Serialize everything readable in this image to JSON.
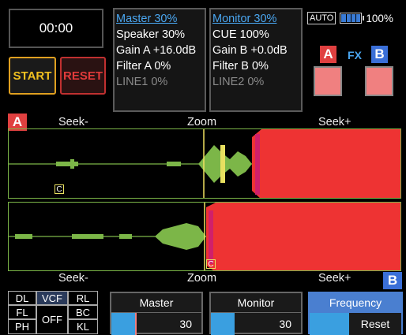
{
  "timer": "00:00",
  "buttons": {
    "start": "START",
    "reset": "RESET"
  },
  "master_panel": {
    "title": "Master 30%",
    "lines": [
      "Speaker 30%",
      "Gain A +16.0dB",
      "Filter A 0%",
      "LINE1 0%"
    ]
  },
  "monitor_panel": {
    "title": "Monitor 30%",
    "lines": [
      "CUE 100%",
      "Gain B +0.0dB",
      "Filter B 0%",
      "LINE2 0%"
    ]
  },
  "status": {
    "auto": "AUTO",
    "battery": "100%",
    "battery_level": 1.0
  },
  "fx": {
    "deck_a": "A",
    "label": "FX",
    "deck_b": "B"
  },
  "deck_a": {
    "label": "A",
    "seek_minus": "Seek-",
    "zoom": "Zoom",
    "seek_plus": "Seek+",
    "cue_marker": "C"
  },
  "deck_b": {
    "label": "B",
    "seek_minus": "Seek-",
    "zoom": "Zoom",
    "seek_plus": "Seek+",
    "cue_marker": "C"
  },
  "effects": {
    "row1": [
      "DL",
      "VCF",
      "RL"
    ],
    "row2_left": "FL",
    "row2_right": "BC",
    "center": "OFF",
    "row3_left": "PH",
    "row3_right": "KL"
  },
  "bottom": {
    "master": {
      "label": "Master",
      "value": "30"
    },
    "monitor": {
      "label": "Monitor",
      "value": "30"
    },
    "frequency": {
      "label": "Frequency",
      "reset": "Reset"
    }
  },
  "colors": {
    "accent_blue": "#4aa6f0",
    "waveform_green": "#7cb648",
    "waveform_red": "#ee3333",
    "playhead": "#f0e060"
  }
}
